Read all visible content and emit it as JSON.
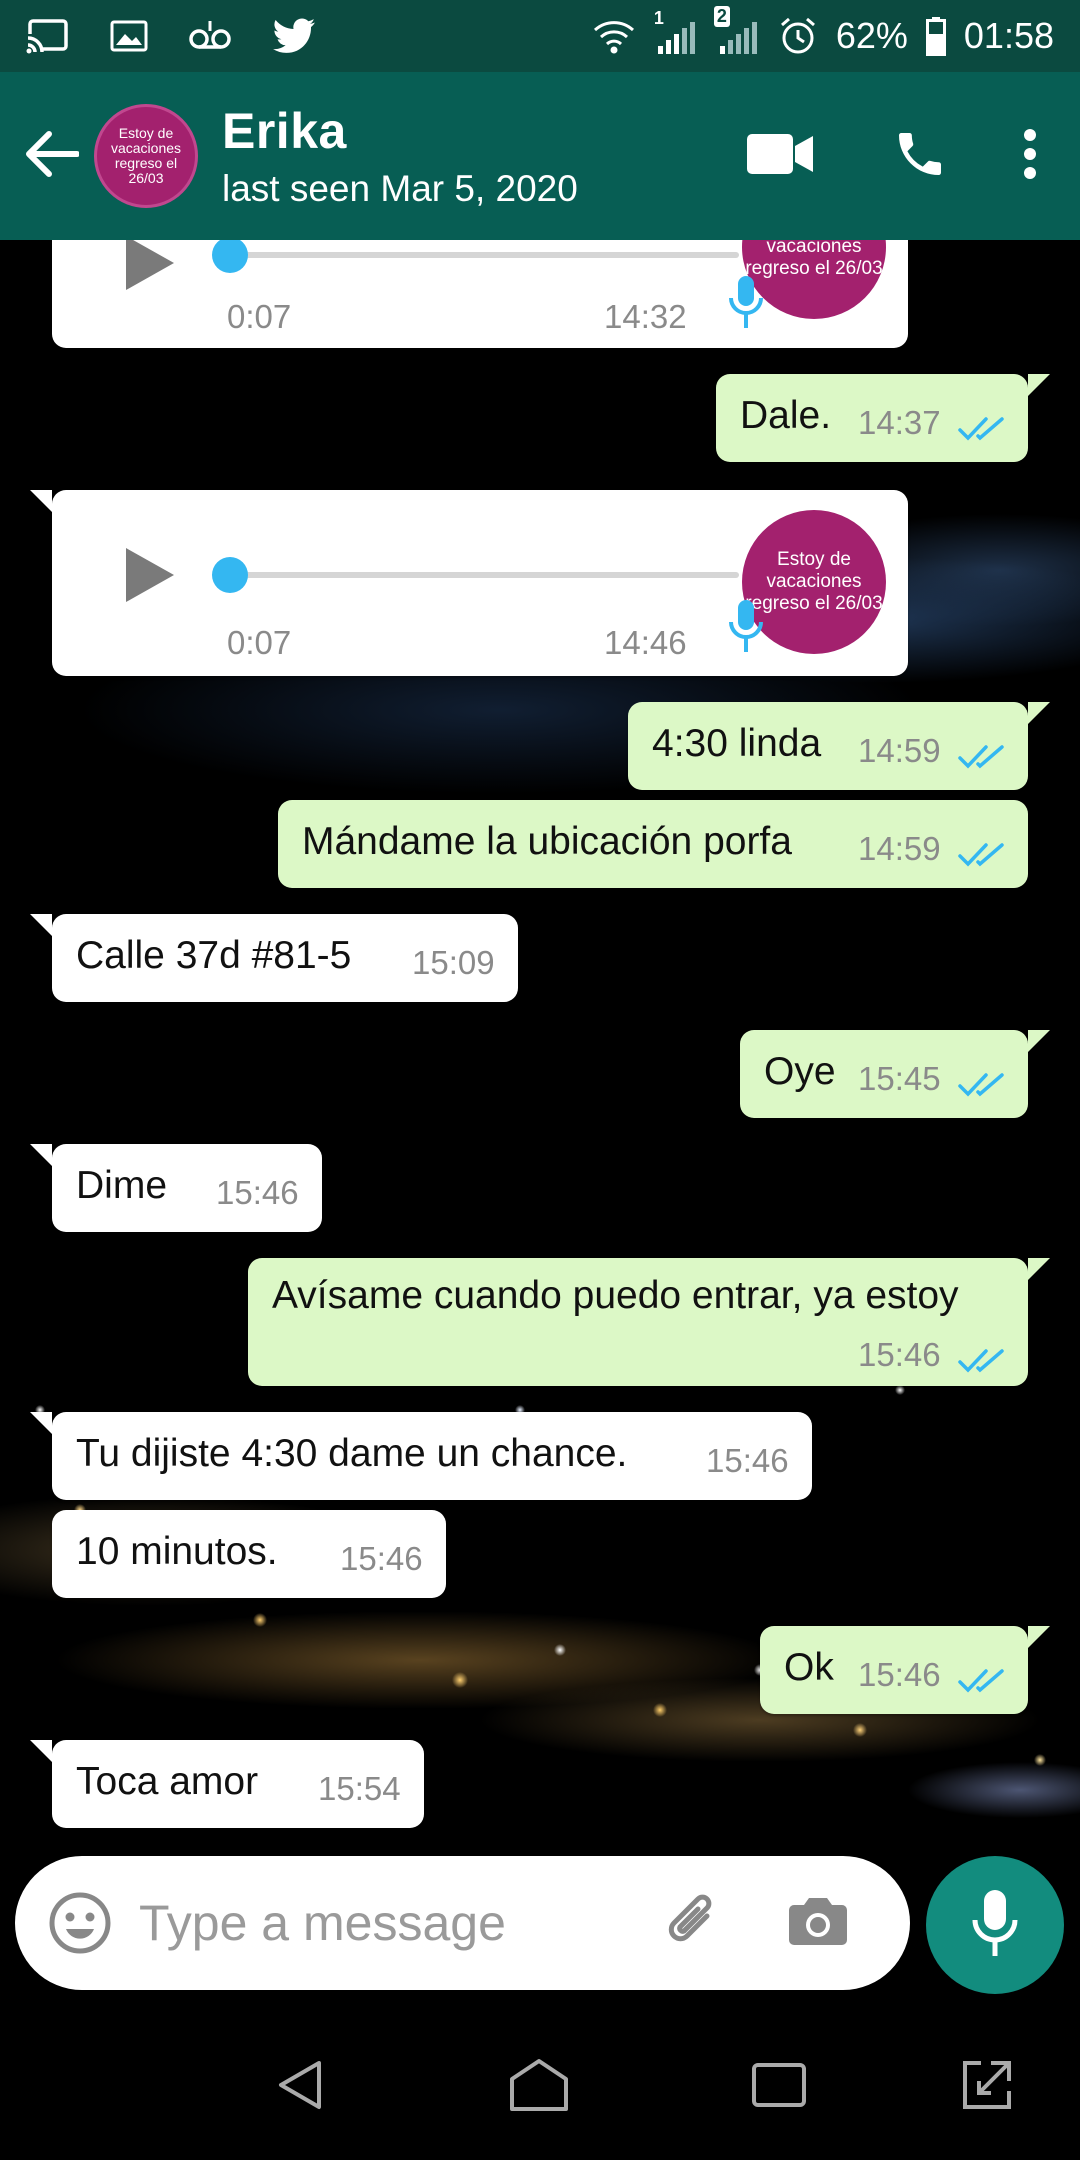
{
  "status_bar": {
    "battery": "62%",
    "time": "01:58",
    "sim1_label": "1",
    "sim2_label": "2"
  },
  "header": {
    "contact_name": "Erika",
    "last_seen": "last seen Mar 5, 2020",
    "avatar_lines": [
      "Estoy de",
      "vacaciones",
      "regreso el 26/03"
    ]
  },
  "messages": [
    {
      "type": "voice",
      "direction": "in",
      "duration": "0:07",
      "time": "14:32",
      "progress": 0
    },
    {
      "type": "text",
      "direction": "out",
      "text": "Dale.",
      "time": "14:37",
      "status": "read"
    },
    {
      "type": "voice",
      "direction": "in",
      "duration": "0:07",
      "time": "14:46",
      "progress": 0
    },
    {
      "type": "text",
      "direction": "out",
      "text": "4:30 linda",
      "time": "14:59",
      "status": "read"
    },
    {
      "type": "text",
      "direction": "out",
      "text": "Mándame la ubicación porfa",
      "time": "14:59",
      "status": "read"
    },
    {
      "type": "text",
      "direction": "in",
      "text": "Calle 37d #81-5",
      "time": "15:09"
    },
    {
      "type": "text",
      "direction": "out",
      "text": "Oye",
      "time": "15:45",
      "status": "read"
    },
    {
      "type": "text",
      "direction": "in",
      "text": "Dime",
      "time": "15:46"
    },
    {
      "type": "text",
      "direction": "out",
      "text": "Avísame cuando puedo entrar, ya estoy",
      "time": "15:46",
      "status": "read"
    },
    {
      "type": "text",
      "direction": "in",
      "text": "Tu dijiste 4:30 dame un chance.",
      "time": "15:46"
    },
    {
      "type": "text",
      "direction": "in",
      "text": "10 minutos.",
      "time": "15:46"
    },
    {
      "type": "text",
      "direction": "out",
      "text": "Ok",
      "time": "15:46",
      "status": "read"
    },
    {
      "type": "text",
      "direction": "in",
      "text": "Toca amor",
      "time": "15:54"
    }
  ],
  "input": {
    "placeholder": "Type a message",
    "value": ""
  },
  "icons": {
    "status_left": [
      "cast-icon",
      "image-icon",
      "voicemail-icon",
      "twitter-icon"
    ],
    "status_right": [
      "wifi-icon",
      "signal-icon",
      "signal-icon",
      "alarm-icon",
      "battery-icon"
    ],
    "header": [
      "back-arrow-icon",
      "video-call-icon",
      "phone-icon",
      "more-vert-icon"
    ],
    "input": [
      "emoji-icon",
      "attach-icon",
      "camera-icon",
      "mic-icon"
    ],
    "nav": [
      "back-triangle-icon",
      "home-icon",
      "recents-icon",
      "expand-icon"
    ]
  },
  "colors": {
    "status_bar": "#0b4a40",
    "header": "#075e54",
    "outgoing_bubble": "#dcf8c6",
    "incoming_bubble": "#ffffff",
    "read_ticks": "#34b7f1",
    "fab": "#128c7e",
    "avatar": "#a3216e"
  }
}
